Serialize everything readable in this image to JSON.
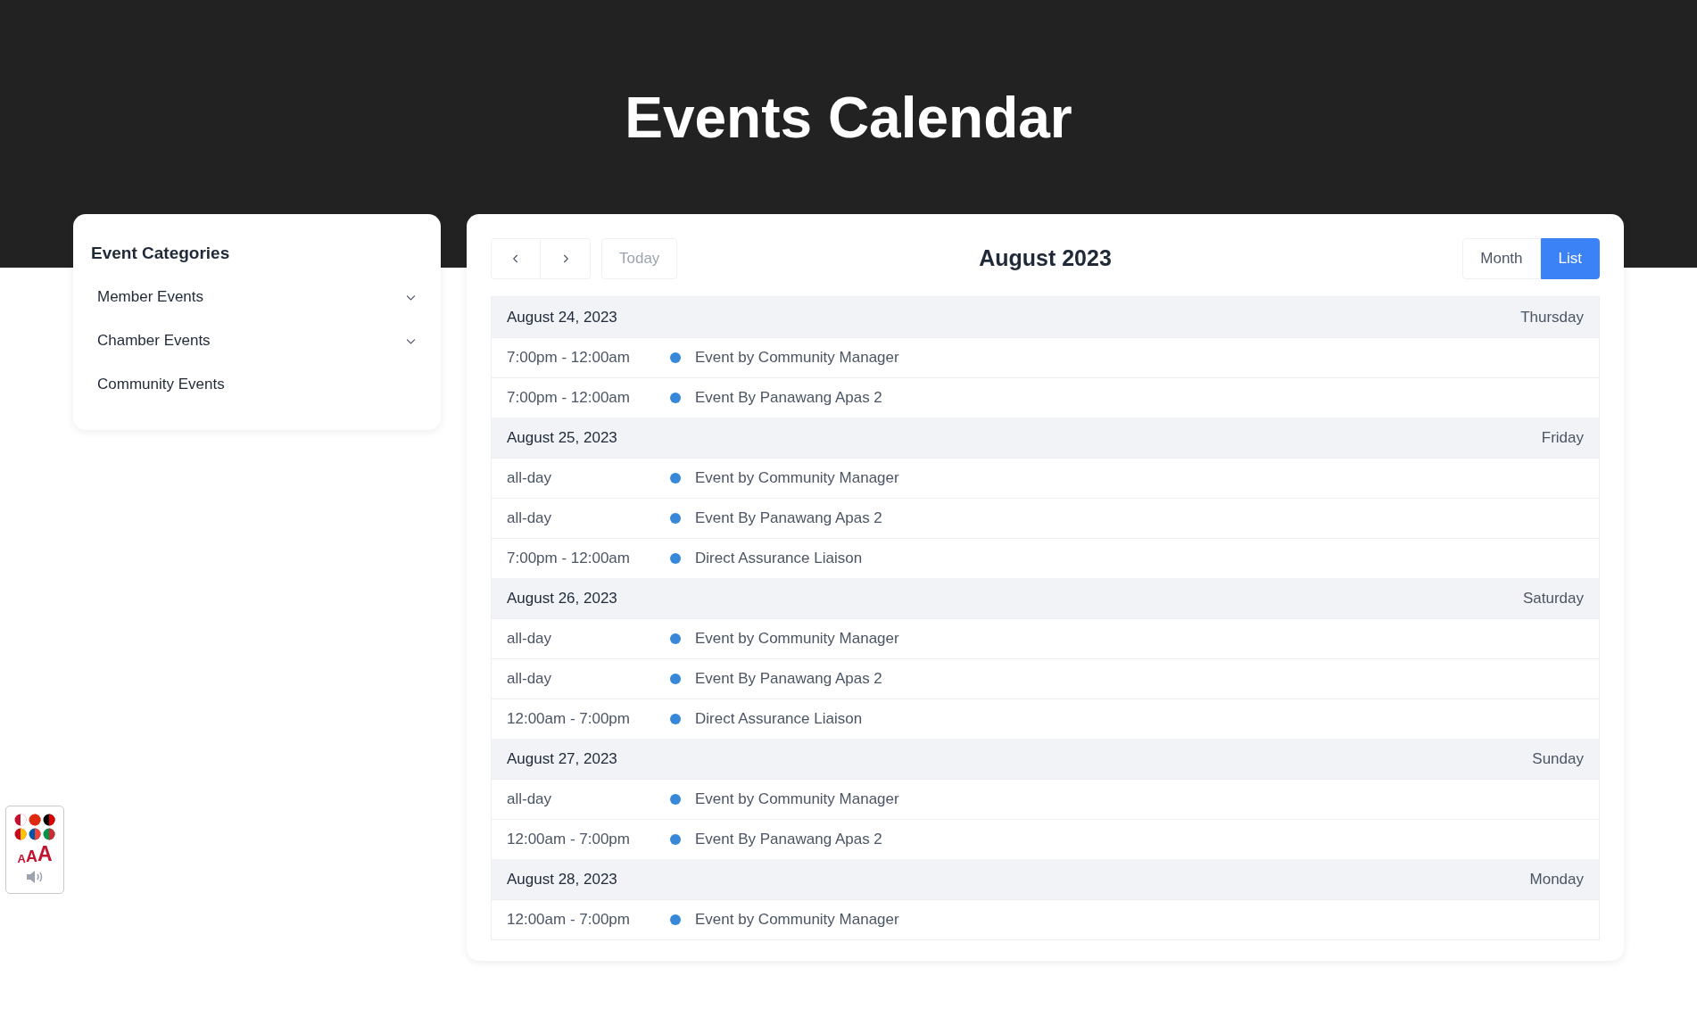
{
  "page": {
    "title": "Events Calendar"
  },
  "sidebar": {
    "title": "Event Categories",
    "items": [
      {
        "label": "Member Events",
        "kind": "group",
        "expanded": false
      },
      {
        "label": "Chamber Events",
        "kind": "group",
        "expanded": false
      },
      {
        "label": "Community Events",
        "kind": "item"
      }
    ]
  },
  "toolbar": {
    "today": "Today",
    "title": "August 2023",
    "views": [
      {
        "label": "Month",
        "selected": false
      },
      {
        "label": "List",
        "selected": true
      }
    ]
  },
  "days": [
    {
      "date": "August 24, 2023",
      "weekday": "Thursday",
      "events": [
        {
          "time": "7:00pm - 12:00am",
          "title": "Event by Community Manager",
          "color": "#3788d8"
        },
        {
          "time": "7:00pm - 12:00am",
          "title": "Event By Panawang Apas 2",
          "color": "#3788d8"
        }
      ]
    },
    {
      "date": "August 25, 2023",
      "weekday": "Friday",
      "events": [
        {
          "time": "all-day",
          "title": "Event by Community Manager",
          "color": "#3788d8"
        },
        {
          "time": "all-day",
          "title": "Event By Panawang Apas 2",
          "color": "#3788d8"
        },
        {
          "time": "7:00pm - 12:00am",
          "title": "Direct Assurance Liaison",
          "color": "#3788d8"
        }
      ]
    },
    {
      "date": "August 26, 2023",
      "weekday": "Saturday",
      "events": [
        {
          "time": "all-day",
          "title": "Event by Community Manager",
          "color": "#3788d8"
        },
        {
          "time": "all-day",
          "title": "Event By Panawang Apas 2",
          "color": "#3788d8"
        },
        {
          "time": "12:00am - 7:00pm",
          "title": "Direct Assurance Liaison",
          "color": "#3788d8"
        }
      ]
    },
    {
      "date": "August 27, 2023",
      "weekday": "Sunday",
      "events": [
        {
          "time": "all-day",
          "title": "Event by Community Manager",
          "color": "#3788d8"
        },
        {
          "time": "12:00am - 7:00pm",
          "title": "Event By Panawang Apas 2",
          "color": "#3788d8"
        }
      ]
    },
    {
      "date": "August 28, 2023",
      "weekday": "Monday",
      "events": [
        {
          "time": "12:00am - 7:00pm",
          "title": "Event by Community Manager",
          "color": "#3788d8"
        }
      ]
    }
  ],
  "accessibility_widget": {
    "letters": [
      "A",
      "A",
      "A"
    ]
  }
}
